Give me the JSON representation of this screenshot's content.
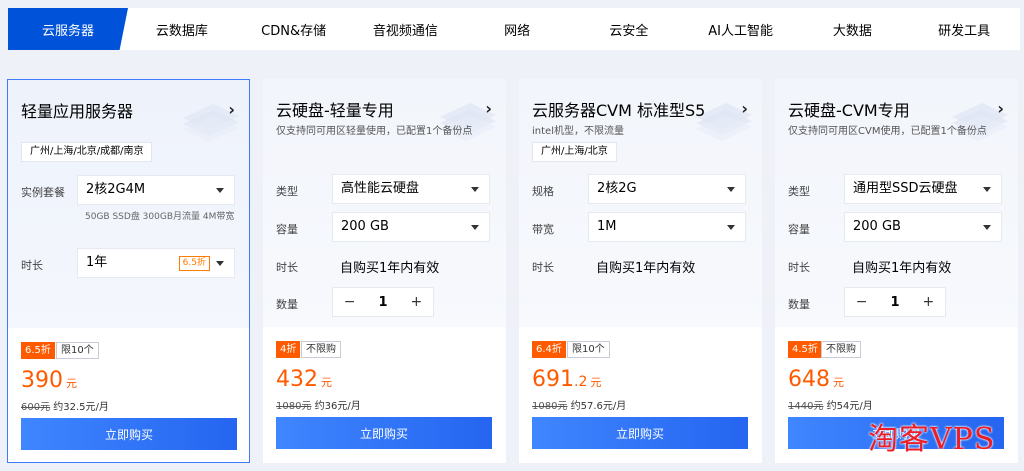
{
  "tabs": [
    {
      "label": "云服务器",
      "active": true
    },
    {
      "label": "云数据库"
    },
    {
      "label": "CDN&存储"
    },
    {
      "label": "音视频通信"
    },
    {
      "label": "网络"
    },
    {
      "label": "云安全"
    },
    {
      "label": "AI人工智能"
    },
    {
      "label": "大数据"
    },
    {
      "label": "研发工具"
    }
  ],
  "cards": [
    {
      "title": "轻量应用服务器",
      "region": "广州/上海/北京/成都/南京",
      "rows": [
        {
          "label": "实例套餐",
          "value": "2核2G4M",
          "hint": "50GB SSD盘 300GB月流量 4M带宽"
        },
        {
          "label": "时长",
          "value": "1年",
          "tag": "6.5折"
        }
      ],
      "discount": "6.5折",
      "limit": "限10个",
      "price": "390",
      "unit": "元",
      "original": "600元",
      "monthly": "约32.5元/月",
      "buy_label": "立即购买"
    },
    {
      "title": "云硬盘-轻量专用",
      "subtitle": "仅支持同可用区轻量使用，已配置1个备份点",
      "rows": [
        {
          "label": "类型",
          "value": "高性能云硬盘"
        },
        {
          "label": "容量",
          "value": "200 GB"
        },
        {
          "label": "时长",
          "value": "自购买1年内有效"
        },
        {
          "label": "数量",
          "minus": "−",
          "qty": "1",
          "plus": "+"
        }
      ],
      "discount": "4折",
      "limit": "不限购",
      "price": "432",
      "unit": "元",
      "original": "1080元",
      "monthly": "约36元/月",
      "buy_label": "立即购买"
    },
    {
      "title": "云服务器CVM 标准型S5",
      "subtitle": "intel机型，不限流量",
      "region": "广州/上海/北京",
      "rows": [
        {
          "label": "规格",
          "value": "2核2G"
        },
        {
          "label": "带宽",
          "value": "1M"
        },
        {
          "label": "时长",
          "value": "自购买1年内有效"
        }
      ],
      "discount": "6.4折",
      "limit": "限10个",
      "price": "691",
      "price_decimal": ".2",
      "unit": "元",
      "original": "1080元",
      "monthly": "约57.6元/月",
      "buy_label": "立即购买"
    },
    {
      "title": "云硬盘-CVM专用",
      "subtitle": "仅支持同可用区CVM使用，已配置1个备份点",
      "rows": [
        {
          "label": "类型",
          "value": "通用型SSD云硬盘"
        },
        {
          "label": "容量",
          "value": "200 GB"
        },
        {
          "label": "时长",
          "value": "自购买1年内有效"
        },
        {
          "label": "数量",
          "minus": "−",
          "qty": "1",
          "plus": "+"
        }
      ],
      "discount": "4.5折",
      "limit": "不限购",
      "price": "648",
      "unit": "元",
      "original": "1440元",
      "monthly": "约54元/月",
      "buy_label": "立即购买"
    }
  ],
  "watermark": "淘客VPS",
  "colors": {
    "accent": "#0052d9",
    "price": "#ff5a00",
    "buy": "#2f6ff5"
  }
}
